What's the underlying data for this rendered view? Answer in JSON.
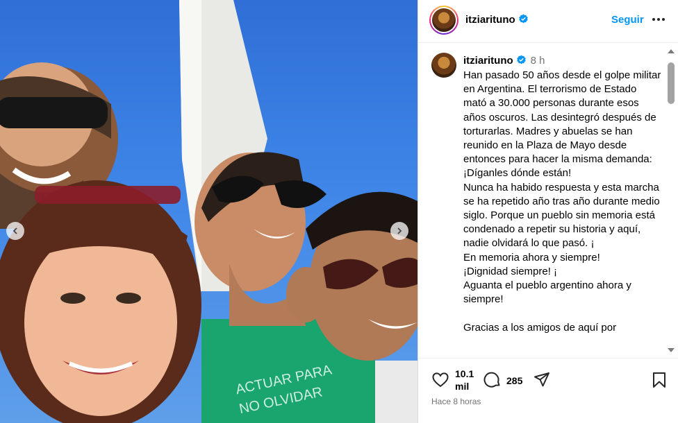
{
  "post": {
    "username": "itziarituno",
    "follow_label": "Seguir",
    "time_short": "8 h",
    "caption": "Han pasado 50 años desde el golpe militar en Argentina. El terrorismo de Estado mató a 30.000 personas durante esos años oscuros. Las desintegró después de torturarlas. Madres y abuelas se han reunido en la Plaza de Mayo desde entonces para hacer la misma demanda: ¡Díganles dónde están!\nNunca ha habido respuesta y esta marcha se ha repetido año tras año durante medio siglo. Porque un pueblo sin memoria está condenado a repetir su historia y aquí, nadie olvidará lo que pasó. ¡\nEn memoria ahora y siempre!\n¡Dignidad siempre! ¡\nAguanta el pueblo argentino ahora y siempre!\n\nGracias a los amigos de aquí por",
    "likes": "10.1\nmil",
    "comments_count": "285",
    "time_ago": "Hace 8 horas"
  },
  "photo": {
    "shirt_text_line1": "ACTUAR PARA",
    "shirt_text_line2": "NO OLVIDAR"
  },
  "icons": {
    "header_more": "more-horizontal-icon",
    "verified": "verified-badge-icon",
    "like": "heart-icon",
    "comment": "comment-icon",
    "share": "share-icon",
    "save": "bookmark-icon",
    "prev": "chevron-left-icon",
    "next": "chevron-right-icon"
  },
  "colors": {
    "accent": "#0095f6",
    "verified": "#0095f6",
    "muted": "#737373",
    "sky": "#3f86e8"
  }
}
